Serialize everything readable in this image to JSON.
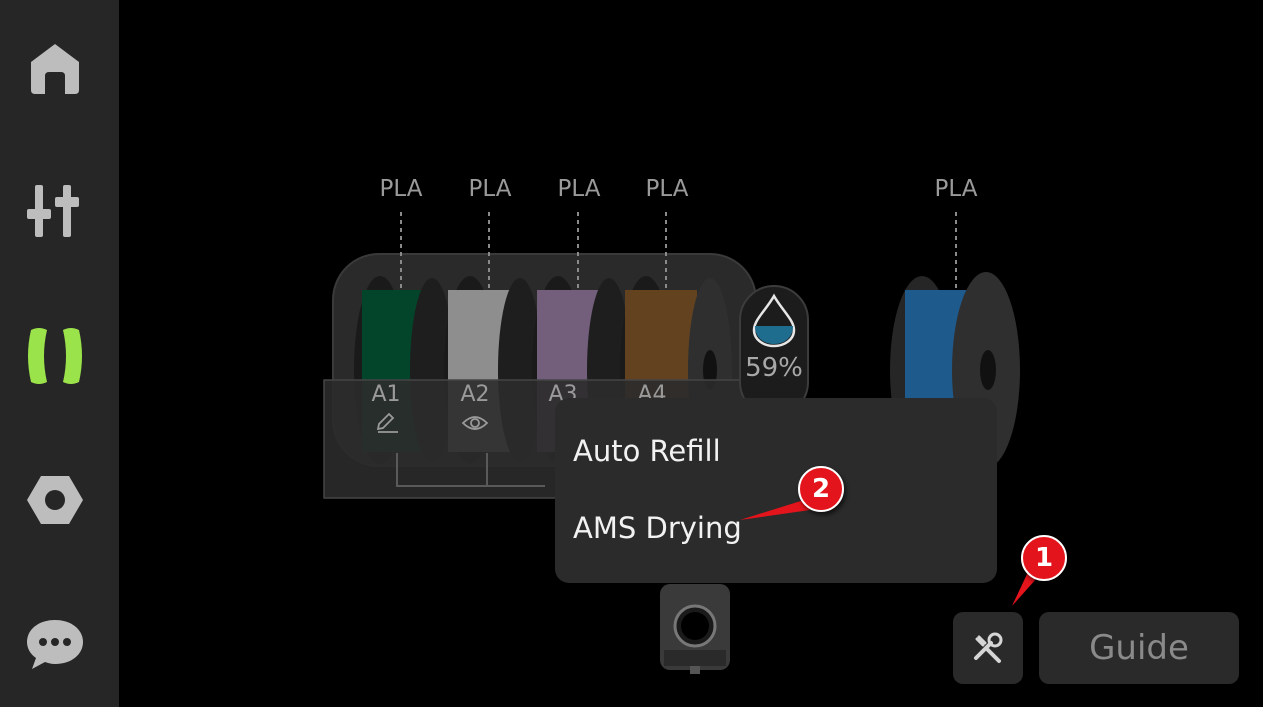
{
  "sidebar": {
    "items": [
      {
        "icon": "home-icon"
      },
      {
        "icon": "controls-icon"
      },
      {
        "icon": "filament-icon",
        "active": true
      },
      {
        "icon": "settings-icon"
      },
      {
        "icon": "messages-icon"
      }
    ],
    "active_color": "#9be34b"
  },
  "ams": {
    "slots": [
      {
        "material": "PLA",
        "id": "A1",
        "color": "#03452a",
        "icon": "pencil-icon"
      },
      {
        "material": "PLA",
        "id": "A2",
        "color": "#8e8e8e",
        "icon": "eye-icon"
      },
      {
        "material": "PLA",
        "id": "A3",
        "color": "#735e7b"
      },
      {
        "material": "PLA",
        "id": "A4",
        "color": "#634220"
      }
    ],
    "humidity": "59%",
    "external_spool": {
      "material": "PLA",
      "color": "#1f5a8c"
    }
  },
  "menu": {
    "items": [
      "Auto Refill",
      "AMS Drying"
    ]
  },
  "buttons": {
    "tools_icon": "tools-icon",
    "guide_label": "Guide"
  },
  "annotations": [
    "1",
    "2"
  ],
  "colors": {
    "badge": "#e3141b",
    "background": "#000000",
    "sidebar": "#262626"
  }
}
